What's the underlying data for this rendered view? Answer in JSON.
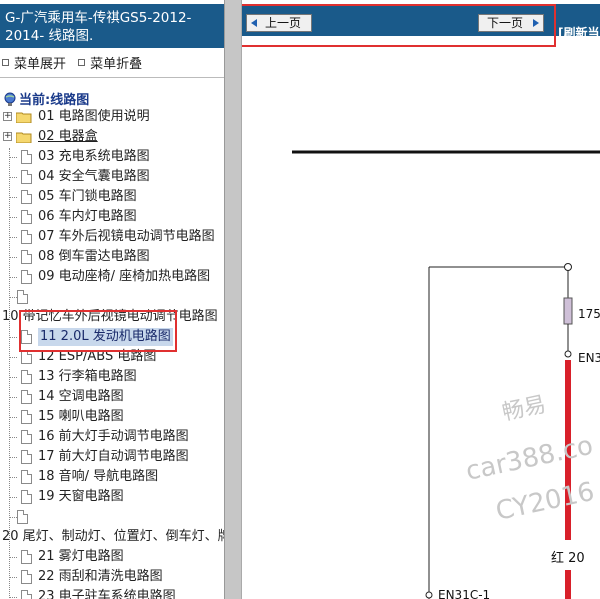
{
  "left_panel": {
    "title": "G-广汽乘用车-传祺GS5-2012-2014- 线路图.",
    "menu": {
      "expand": "菜单展开",
      "collapse": "菜单折叠"
    },
    "current_label": "当前:线路图",
    "tree": [
      {
        "label": "01 电路图使用说明",
        "type": "folder"
      },
      {
        "label": "02 电器盒",
        "type": "folder"
      },
      {
        "label": "03 充电系统电路图",
        "type": "doc"
      },
      {
        "label": "04 安全气囊电路图",
        "type": "doc"
      },
      {
        "label": "05 车门锁电路图",
        "type": "doc"
      },
      {
        "label": "06 车内灯电路图",
        "type": "doc"
      },
      {
        "label": "07 车外后视镜电动调节电路图",
        "type": "doc"
      },
      {
        "label": "08 倒车雷达电路图",
        "type": "doc"
      },
      {
        "label": "09 电动座椅/ 座椅加热电路图",
        "type": "doc"
      },
      {
        "label": "",
        "type": "doc"
      },
      {
        "label": "10 带记忆车外后视镜电动调节电路图",
        "type": "plain"
      },
      {
        "label": "11 2.0L 发动机电路图",
        "type": "doc",
        "selected": true
      },
      {
        "label": "12 ESP/ABS 电路图",
        "type": "doc"
      },
      {
        "label": "13 行李箱电路图",
        "type": "doc"
      },
      {
        "label": "14 空调电路图",
        "type": "doc"
      },
      {
        "label": "15 喇叭电路图",
        "type": "doc"
      },
      {
        "label": "16 前大灯手动调节电路图",
        "type": "doc"
      },
      {
        "label": "17 前大灯自动调节电路图",
        "type": "doc"
      },
      {
        "label": "18 音响/ 导航电路图",
        "type": "doc"
      },
      {
        "label": "19 天窗电路图",
        "type": "doc"
      },
      {
        "label": "",
        "type": "doc"
      },
      {
        "label": "20 尾灯、制动灯、位置灯、倒车灯、牌",
        "type": "plain"
      },
      {
        "label": "21 雾灯电路图",
        "type": "doc"
      },
      {
        "label": "22 雨刮和清洗电路图",
        "type": "doc"
      },
      {
        "label": "23 电子驻车系统电路图",
        "type": "doc"
      }
    ]
  },
  "right_panel": {
    "prev_label": "上一页",
    "next_label": "下一页",
    "refresh_label": "[刷新当",
    "diagram": {
      "fuse_label": "175",
      "connector_top": "EN3",
      "wire_label": "红  20",
      "connector_bottom": "EN31C-1",
      "watermark": [
        "畅易",
        "car388.co",
        "CY2016"
      ]
    }
  },
  "colors": {
    "header_bg": "#1a5a8a",
    "highlight_box": "#e03030",
    "wire_red": "#d8202a"
  }
}
